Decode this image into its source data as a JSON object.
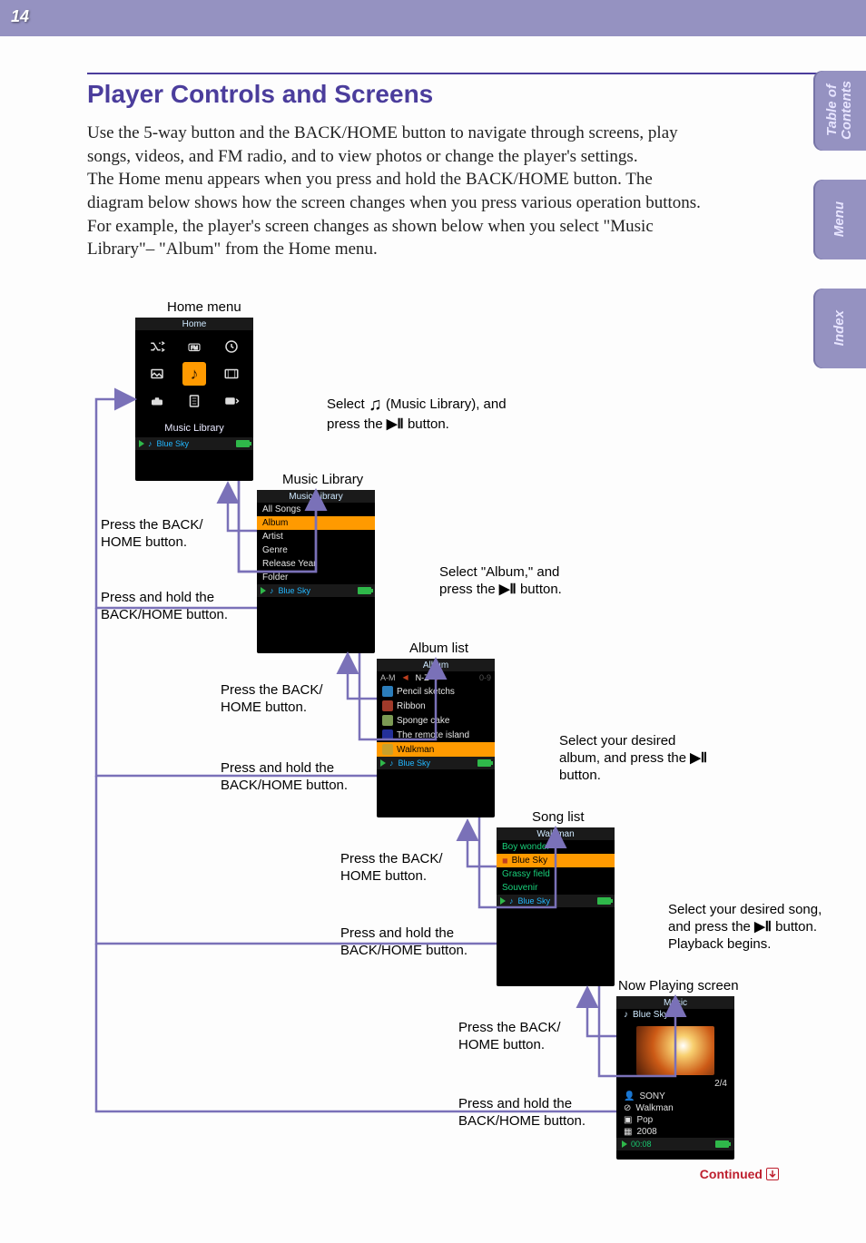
{
  "page_number": "14",
  "heading": "Player Controls and Screens",
  "paragraph1": "Use the 5-way button and the BACK/HOME button to navigate through screens, play songs, videos, and FM radio, and to view photos or change the player's settings.",
  "paragraph2": "The Home menu appears when you press and hold the BACK/HOME button. The diagram below shows how the screen changes when you press various operation buttons. For example, the player's screen changes as shown below when you select \"Music Library\"– \"Album\" from the Home menu.",
  "side_tabs": {
    "toc": "Table of\nContents",
    "menu": "Menu",
    "index": "Index"
  },
  "continued": "Continued",
  "labels": {
    "home_menu": "Home menu",
    "music_library": "Music Library",
    "album_list": "Album list",
    "song_list": "Song list",
    "now_playing": "Now Playing screen",
    "select_music_pre": "Select ",
    "select_music_post": " (Music Library), and press the ",
    "button_suffix": " button.",
    "select_album_pre": "Select \"Album,\" and press the ",
    "select_desired_album_pre": "Select your desired album, and press the ",
    "select_desired_song_pre": "Select your desired song, and press the ",
    "playback_begins": " button. Playback begins.",
    "press_back": "Press the BACK/\nHOME button.",
    "press_hold_back": "Press and hold the BACK/HOME button."
  },
  "home_screen": {
    "title": "Home",
    "ml_label": "Music Library",
    "now_playing": "Blue Sky"
  },
  "library_screen": {
    "title": "Music Library",
    "items": [
      "All Songs",
      "Album",
      "Artist",
      "Genre",
      "Release Year",
      "Folder"
    ],
    "selected_index": 1,
    "now_playing": "Blue Sky"
  },
  "album_screen": {
    "title": "Album",
    "tabs": {
      "left": "A-M",
      "mid": "N-Z",
      "right": "0-9"
    },
    "items": [
      "Pencil sketchs",
      "Ribbon",
      "Sponge cake",
      "The remote island",
      "Walkman"
    ],
    "selected_index": 4,
    "now_playing": "Blue Sky"
  },
  "song_screen": {
    "title": "Walkman",
    "items": [
      "Boy wonder",
      "Blue Sky",
      "Grassy field",
      "Souvenir"
    ],
    "selected_index": 1,
    "now_playing": "Blue Sky"
  },
  "now_playing_screen": {
    "title": "Music",
    "track": "Blue Sky",
    "count": "2/4",
    "artist": "SONY",
    "album": "Walkman",
    "genre": "Pop",
    "year": "2008",
    "time": "00:08"
  }
}
